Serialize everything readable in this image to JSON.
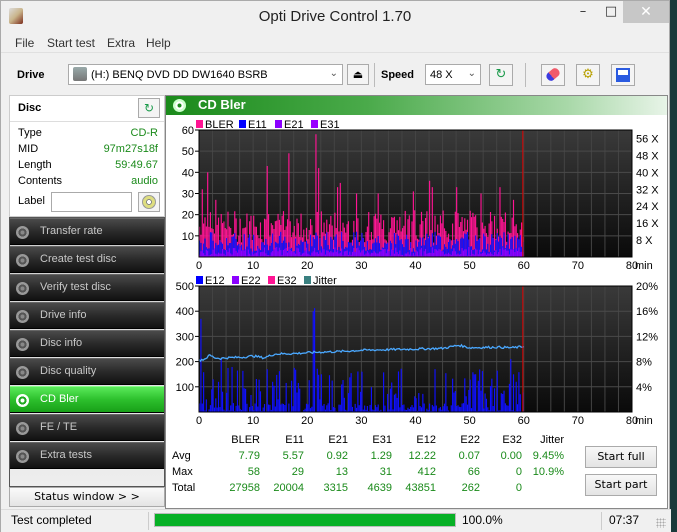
{
  "window": {
    "title": "Opti Drive Control 1.70",
    "controls": {
      "minimize": "–",
      "maximize": "□",
      "close": "✕"
    }
  },
  "menu": [
    "File",
    "Start test",
    "Extra",
    "Help"
  ],
  "toolbar": {
    "drive_label": "Drive",
    "drive_value": "(H:)   BENQ DVD DD DW1640 BSRB",
    "speed_label": "Speed",
    "speed_value": "48 X",
    "icons": [
      "eject-icon",
      "refresh-icon",
      "erase-icon",
      "settings-icon",
      "save-icon"
    ]
  },
  "disc": {
    "title": "Disc",
    "rows": [
      {
        "key": "Type",
        "value": "CD-R"
      },
      {
        "key": "MID",
        "value": "97m27s18f"
      },
      {
        "key": "Length",
        "value": "59:49.67"
      },
      {
        "key": "Contents",
        "value": "audio"
      }
    ],
    "label_key": "Label",
    "label_value": ""
  },
  "nav": [
    {
      "label": "Transfer rate",
      "active": false
    },
    {
      "label": "Create test disc",
      "active": false
    },
    {
      "label": "Verify test disc",
      "active": false
    },
    {
      "label": "Drive info",
      "active": false
    },
    {
      "label": "Disc info",
      "active": false
    },
    {
      "label": "Disc quality",
      "active": false
    },
    {
      "label": "CD Bler",
      "active": true
    },
    {
      "label": "FE / TE",
      "active": false
    },
    {
      "label": "Extra tests",
      "active": false
    }
  ],
  "status_window_button": "Status window > >",
  "main": {
    "title": "CD Bler",
    "start_full": "Start full",
    "start_part": "Start part"
  },
  "stats": {
    "columns": [
      "BLER",
      "E11",
      "E21",
      "E31",
      "E12",
      "E22",
      "E32",
      "Jitter"
    ],
    "rows": [
      {
        "label": "Avg",
        "values": [
          "7.79",
          "5.57",
          "0.92",
          "1.29",
          "12.22",
          "0.07",
          "0.00",
          "9.45%"
        ]
      },
      {
        "label": "Max",
        "values": [
          "58",
          "29",
          "13",
          "31",
          "412",
          "66",
          "0",
          "10.9%"
        ]
      },
      {
        "label": "Total",
        "values": [
          "27958",
          "20004",
          "3315",
          "4639",
          "43851",
          "262",
          "0",
          ""
        ]
      }
    ]
  },
  "statusbar": {
    "text": "Test completed",
    "progress": 100.0,
    "progress_label": "100.0%",
    "time": "07:37"
  },
  "chart_data": [
    {
      "type": "bar",
      "title": "BLER / E11 / E21 / E31",
      "legend": [
        {
          "name": "BLER",
          "color": "#ff1493"
        },
        {
          "name": "E11",
          "color": "#0000ff"
        },
        {
          "name": "E21",
          "color": "#8b00ff"
        },
        {
          "name": "E31",
          "color": "#9a00ff"
        }
      ],
      "xlabel": "min",
      "xlim": [
        0,
        80
      ],
      "x_ticks": [
        0,
        10,
        20,
        30,
        40,
        50,
        60,
        70,
        80
      ],
      "ylim": [
        0,
        60
      ],
      "y_ticks": [
        10,
        20,
        30,
        40,
        50,
        60
      ],
      "y2_ticks": [
        "8 X",
        "16 X",
        "24 X",
        "32 X",
        "40 X",
        "48 X",
        "56 X"
      ],
      "end_marker_min": 59.83,
      "series": [
        {
          "name": "BLER",
          "peaks": [
            [
              0.5,
              32
            ],
            [
              1.5,
              40
            ],
            [
              3,
              27
            ],
            [
              12.5,
              43
            ],
            [
              16.5,
              49
            ],
            [
              21.5,
              58
            ],
            [
              22,
              42
            ],
            [
              25.5,
              33
            ],
            [
              26,
              35
            ],
            [
              29,
              30
            ],
            [
              33,
              30
            ],
            [
              39.5,
              31
            ],
            [
              42.5,
              36
            ],
            [
              43,
              33
            ],
            [
              47.5,
              33
            ],
            [
              52,
              30
            ],
            [
              55.5,
              33
            ],
            [
              58,
              27
            ]
          ],
          "typical": 17
        },
        {
          "name": "E11",
          "typical": 8,
          "max": 29
        },
        {
          "name": "E21",
          "typical": 3,
          "max": 13
        },
        {
          "name": "E31",
          "typical": 4,
          "max": 31
        }
      ]
    },
    {
      "type": "bar",
      "title": "E12 / E22 / E32 / Jitter",
      "legend": [
        {
          "name": "E12",
          "color": "#0000ff"
        },
        {
          "name": "E22",
          "color": "#8b00ff"
        },
        {
          "name": "E32",
          "color": "#ff1493"
        },
        {
          "name": "Jitter",
          "color": "#3a8080"
        }
      ],
      "xlabel": "min",
      "xlim": [
        0,
        80
      ],
      "x_ticks": [
        0,
        10,
        20,
        30,
        40,
        50,
        60,
        70,
        80
      ],
      "ylim": [
        0,
        500
      ],
      "y_ticks": [
        100,
        200,
        300,
        400,
        500
      ],
      "y2_ticks": [
        "4%",
        "8%",
        "12%",
        "16%",
        "20%"
      ],
      "y2lim": [
        0,
        20
      ],
      "end_marker_min": 59.83,
      "series": [
        {
          "name": "E12",
          "peaks": [
            [
              0.3,
              370
            ],
            [
              4,
              210
            ],
            [
              13.5,
              120
            ],
            [
              21,
              400
            ],
            [
              21.3,
              412
            ],
            [
              30,
              160
            ],
            [
              43.5,
              170
            ],
            [
              51,
              150
            ],
            [
              57.5,
              210
            ],
            [
              58.5,
              120
            ]
          ],
          "typical": 60
        },
        {
          "name": "Jitter",
          "points": [
            [
              0,
              8.2
            ],
            [
              1,
              8.4
            ],
            [
              2,
              9.0
            ],
            [
              3,
              8.6
            ],
            [
              4,
              8.5
            ],
            [
              5,
              8.6
            ],
            [
              8,
              8.7
            ],
            [
              10,
              8.9
            ],
            [
              12,
              8.6
            ],
            [
              14,
              9.2
            ],
            [
              18,
              9.3
            ],
            [
              22,
              9.5
            ],
            [
              26,
              9.6
            ],
            [
              30,
              9.8
            ],
            [
              35,
              9.9
            ],
            [
              40,
              10.0
            ],
            [
              45,
              10.1
            ],
            [
              48,
              10.6
            ],
            [
              50,
              10.2
            ],
            [
              55,
              10.3
            ],
            [
              58,
              10.2
            ],
            [
              60,
              10.4
            ]
          ]
        }
      ]
    }
  ]
}
